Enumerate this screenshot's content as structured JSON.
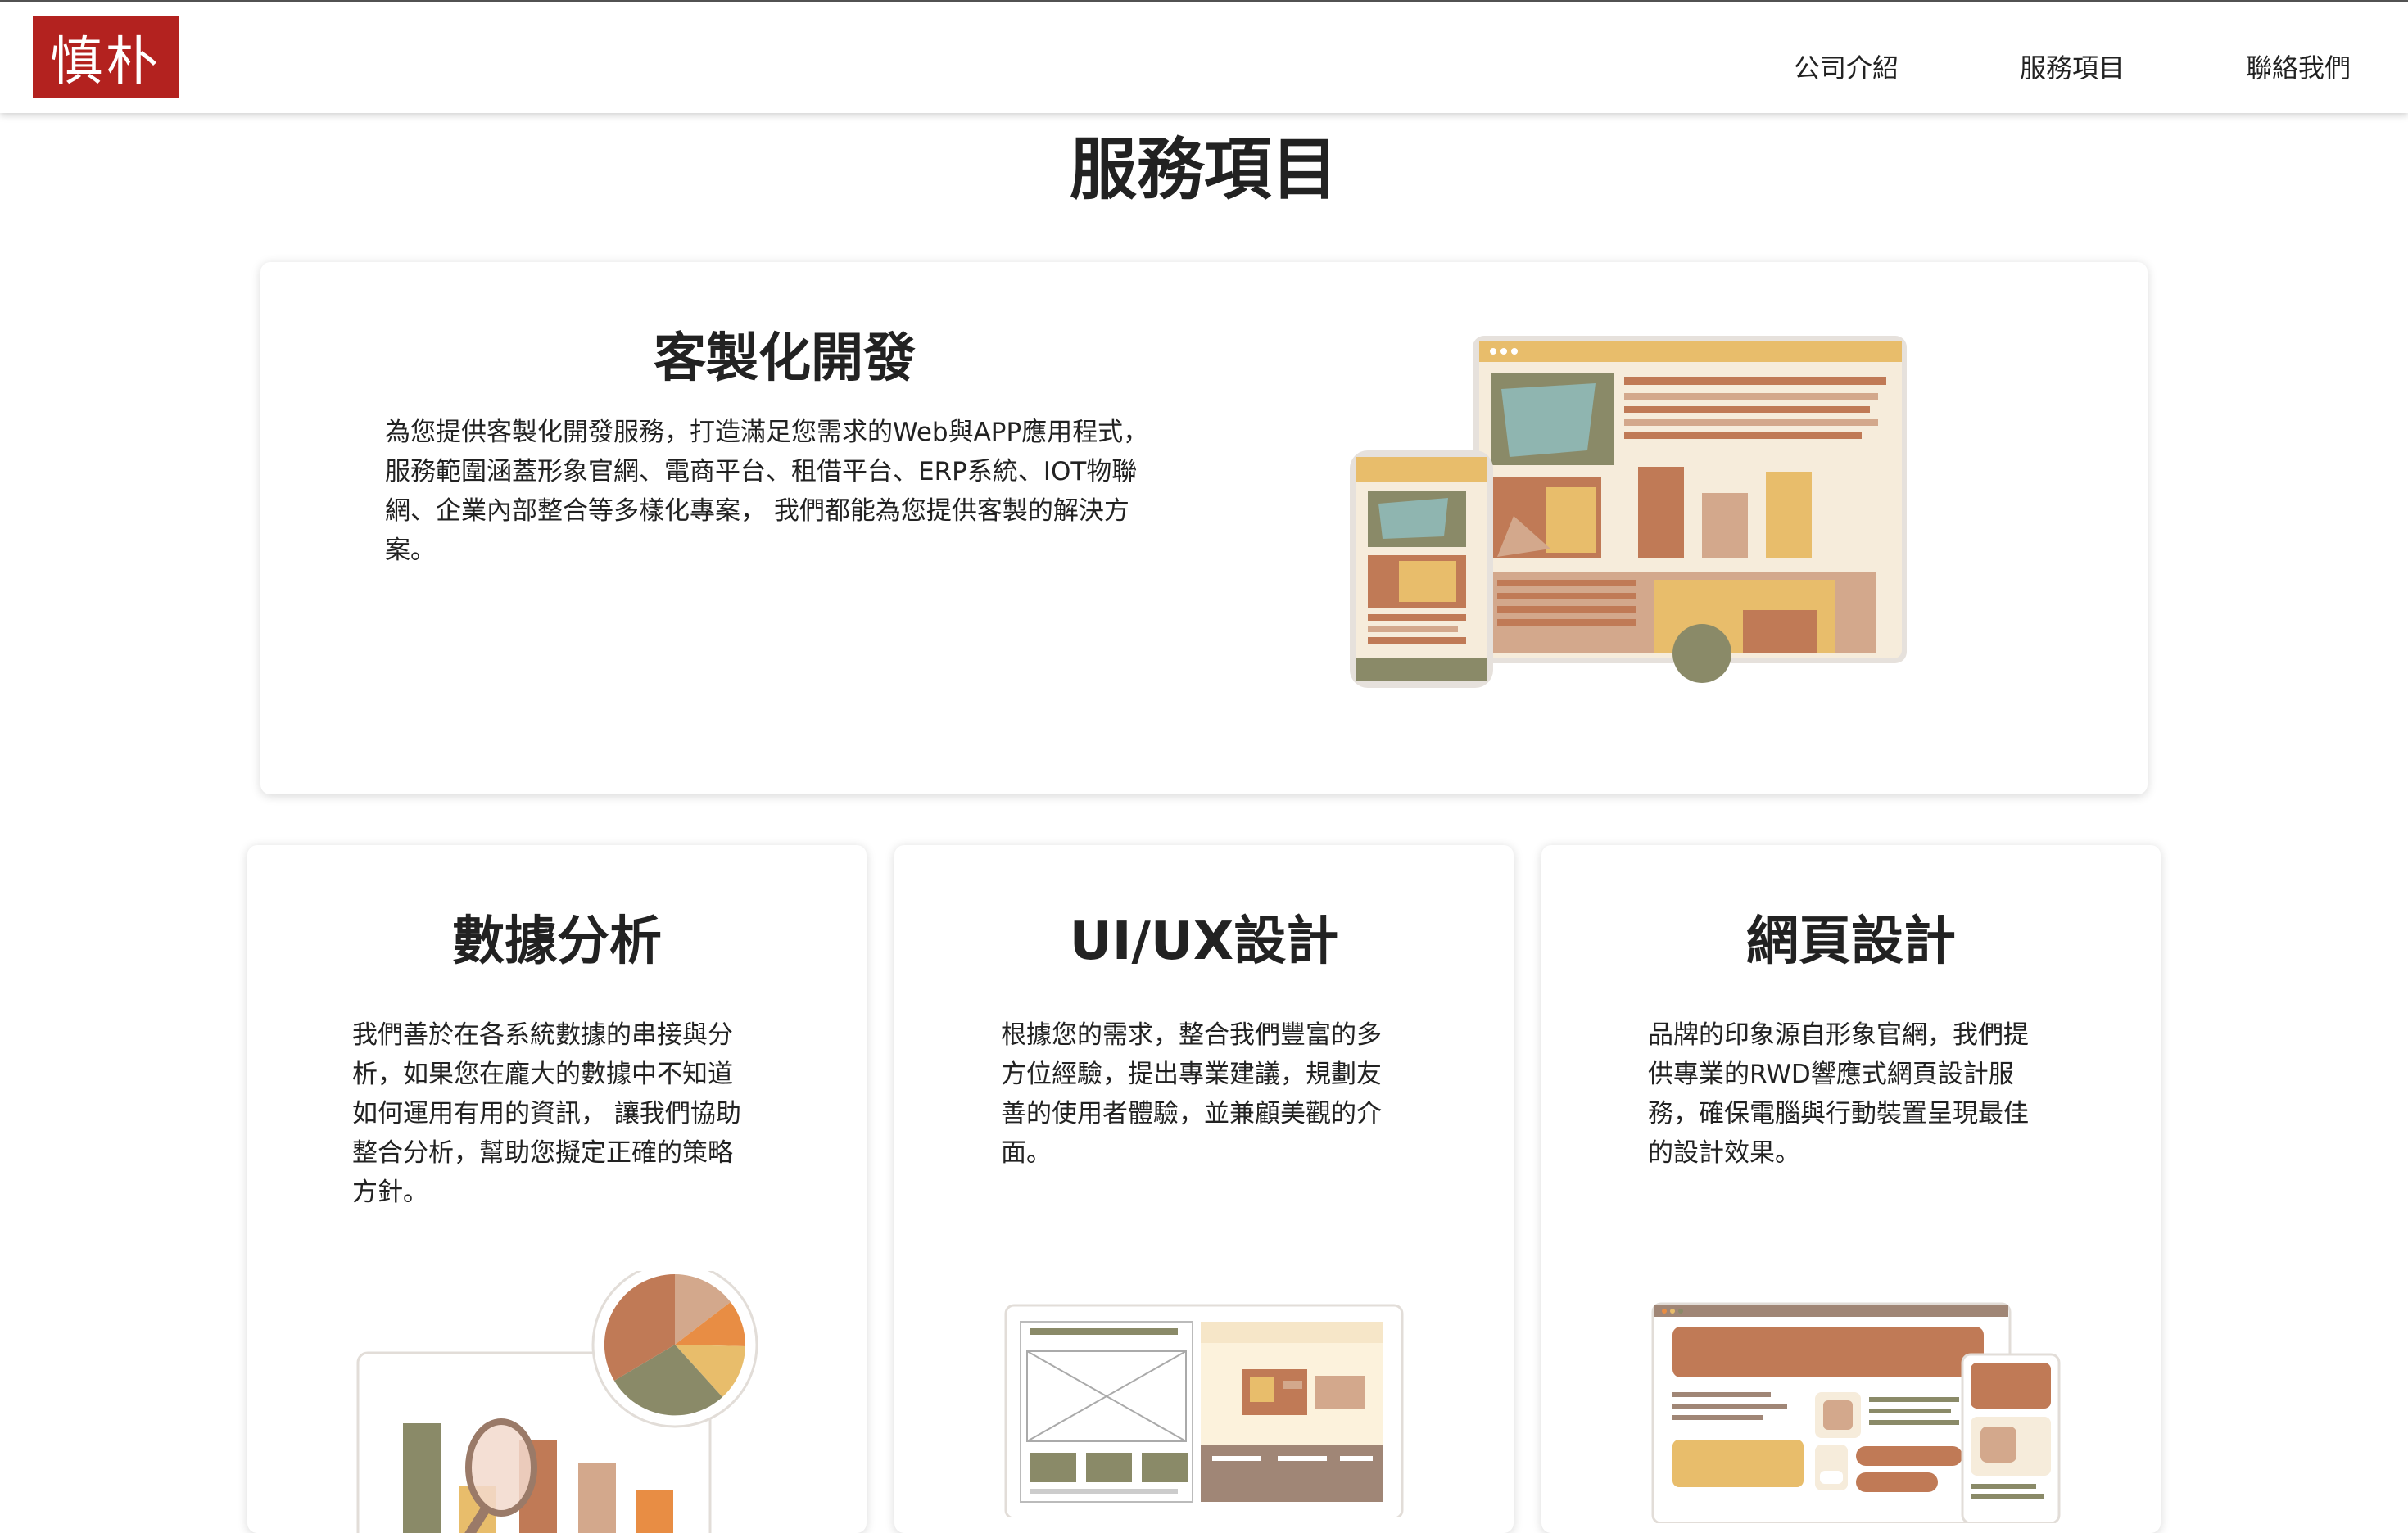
{
  "header": {
    "logo_text": "慎朴",
    "nav": [
      "公司介紹",
      "服務項目",
      "聯絡我們"
    ]
  },
  "page": {
    "title": "服務項目"
  },
  "services": [
    {
      "title": "客製化開發",
      "lines": [
        "為您提供客製化開發服務，打造滿足您需求的Web與APP應用程式，",
        "服務範圍涵蓋形象官網、電商平台、租借平台、ERP系統、IOT物聯",
        "網、企業內部整合等多樣化專案， 我們都能為您提供客製的解決方",
        "案。"
      ]
    },
    {
      "title": "數據分析",
      "lines": [
        "我們善於在各系統數據的串接與分",
        "析，如果您在龐大的數據中不知道",
        "如何運用有用的資訊， 讓我們協助",
        "整合分析，幫助您擬定正確的策略",
        "方針。"
      ]
    },
    {
      "title": "UI/UX設計",
      "lines": [
        "根據您的需求，整合我們豐富的多",
        "方位經驗，提出專業建議，規劃友",
        "善的使用者體驗，並兼顧美觀的介",
        "面。"
      ]
    },
    {
      "title": "網頁設計",
      "lines": [
        "品牌的印象源自形象官網，我們提",
        "供專業的RWD響應式網頁設計服",
        "務，確保電腦與行動裝置呈現最佳",
        "的設計效果。"
      ]
    }
  ],
  "colors": {
    "brand_red": "#b3221f",
    "sand": "#e8bd6b",
    "terracotta": "#c07a56",
    "olive": "#8a8a68",
    "blush": "#d3a88c"
  }
}
